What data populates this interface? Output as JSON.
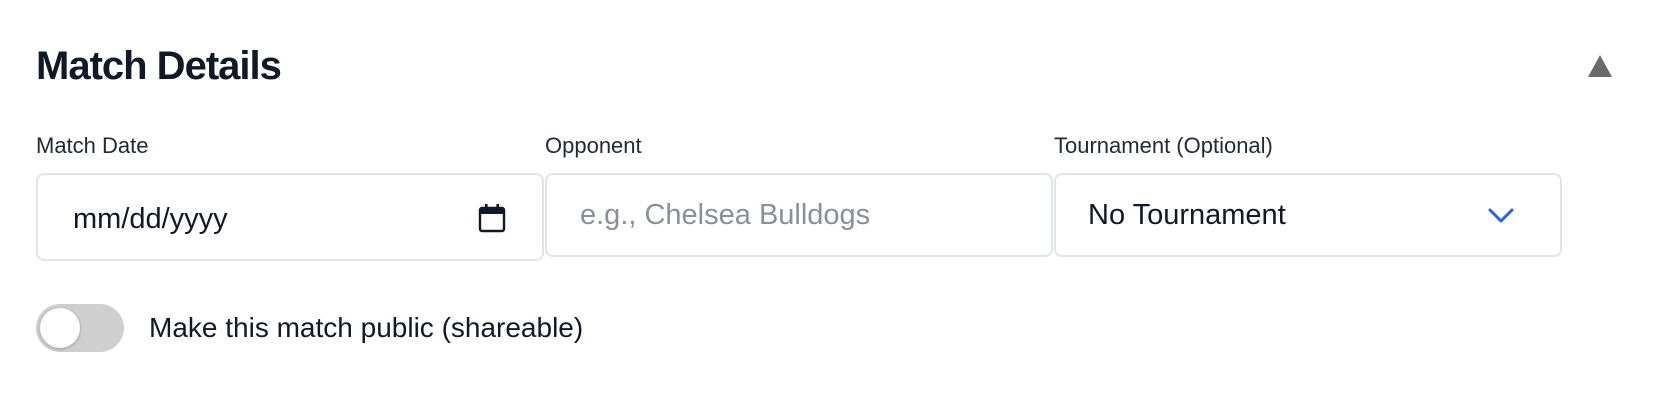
{
  "section": {
    "title": "Match Details",
    "collapse_icon": "triangle-up-icon"
  },
  "fields": {
    "match_date": {
      "label": "Match Date",
      "placeholder": "mm/dd/yyyy",
      "value": "",
      "icon": "calendar-icon"
    },
    "opponent": {
      "label": "Opponent",
      "placeholder": "e.g., Chelsea Bulldogs",
      "value": ""
    },
    "tournament": {
      "label": "Tournament (Optional)",
      "selected": "No Tournament",
      "icon": "chevron-down-icon"
    }
  },
  "public_toggle": {
    "label": "Make this match public (shareable)",
    "checked": false
  },
  "colors": {
    "title": "#111827",
    "border": "#e1e4e8",
    "placeholder": "#8a8f98",
    "chevron": "#2563eb",
    "collapse_triangle": "#6b6b6b",
    "toggle_off": "#cfcfcf"
  }
}
